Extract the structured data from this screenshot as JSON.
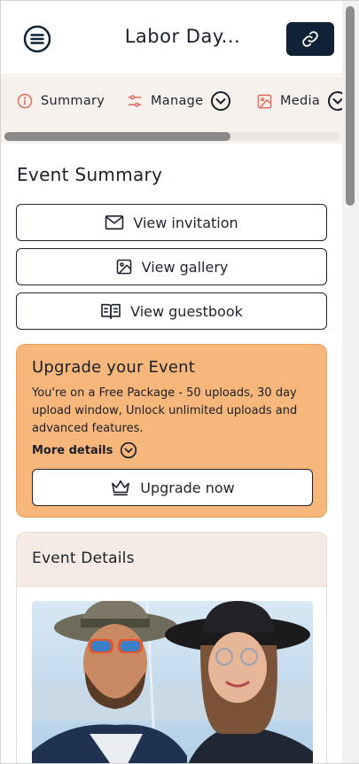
{
  "header": {
    "title": "Labor Day...",
    "menu_icon": "menu-icon",
    "link_icon": "link-icon"
  },
  "tabs": [
    {
      "label": "Summary",
      "icon": "info-icon"
    },
    {
      "label": "Manage",
      "icon": "sliders-icon",
      "has_dropdown": true
    },
    {
      "label": "Media",
      "icon": "image-icon",
      "has_dropdown": true
    }
  ],
  "summary": {
    "title": "Event Summary",
    "buttons": [
      {
        "label": "View invitation",
        "icon": "envelope-icon"
      },
      {
        "label": "View gallery",
        "icon": "image-icon"
      },
      {
        "label": "View guestbook",
        "icon": "book-icon"
      }
    ]
  },
  "upgrade": {
    "title": "Upgrade your Event",
    "description": "You're on a Free Package - 50 uploads, 30 day upload window, Unlock unlimited uploads and advanced features.",
    "more_label": "More details",
    "button_label": "Upgrade now",
    "button_icon": "crown-icon"
  },
  "details": {
    "title": "Event Details"
  },
  "colors": {
    "brand_dark": "#0f2236",
    "upgrade_bg": "#f7b67a",
    "tabs_bg": "#f7f1ed",
    "details_head_bg": "#f5ebe4",
    "info_icon": "#e06a5a"
  }
}
